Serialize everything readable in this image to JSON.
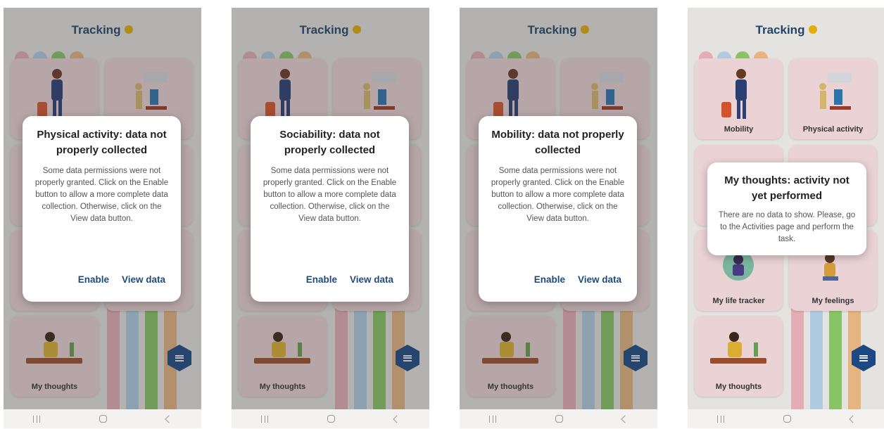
{
  "screens": [
    {
      "app_title": "Tracking",
      "tiles": {
        "top_left": "",
        "top_right": "",
        "bottom": "My thoughts"
      },
      "dialog": {
        "title": "Physical activity: data not properly collected",
        "body": "Some data permissions were not properly granted. Click on the Enable button to allow a more complete data collection. Otherwise, click on the View data button.",
        "enable": "Enable",
        "view": "View data"
      }
    },
    {
      "app_title": "Tracking",
      "tiles": {
        "top_left": "",
        "top_right": "",
        "bottom": "My thoughts"
      },
      "dialog": {
        "title": "Sociability: data not properly collected",
        "body": "Some data permissions were not properly granted. Click on the Enable button to allow a more complete data collection. Otherwise, click on the View data button.",
        "enable": "Enable",
        "view": "View data"
      }
    },
    {
      "app_title": "Tracking",
      "tiles": {
        "top_left": "",
        "top_right": "",
        "bottom": "My thoughts"
      },
      "dialog": {
        "title": "Mobility: data not properly collected",
        "body": "Some data permissions were not properly granted. Click on the Enable button to allow a more complete data collection. Otherwise, click on the View data button.",
        "enable": "Enable",
        "view": "View data"
      }
    },
    {
      "app_title": "Tracking",
      "tiles": {
        "top_left": "Mobility",
        "top_right": "Physical activity",
        "mid_left": "My life tracker",
        "mid_right": "My feelings",
        "bottom": "My thoughts"
      },
      "dialog": {
        "title": "My thoughts: activity not yet performed",
        "body": "There are no data to show. Please, go to the Activities page and perform the task."
      }
    }
  ],
  "colors": {
    "title": "#21456e",
    "accent_button": "#1f4b7a",
    "fab": "#1a4a8a",
    "info_dot": "#f2b705"
  }
}
